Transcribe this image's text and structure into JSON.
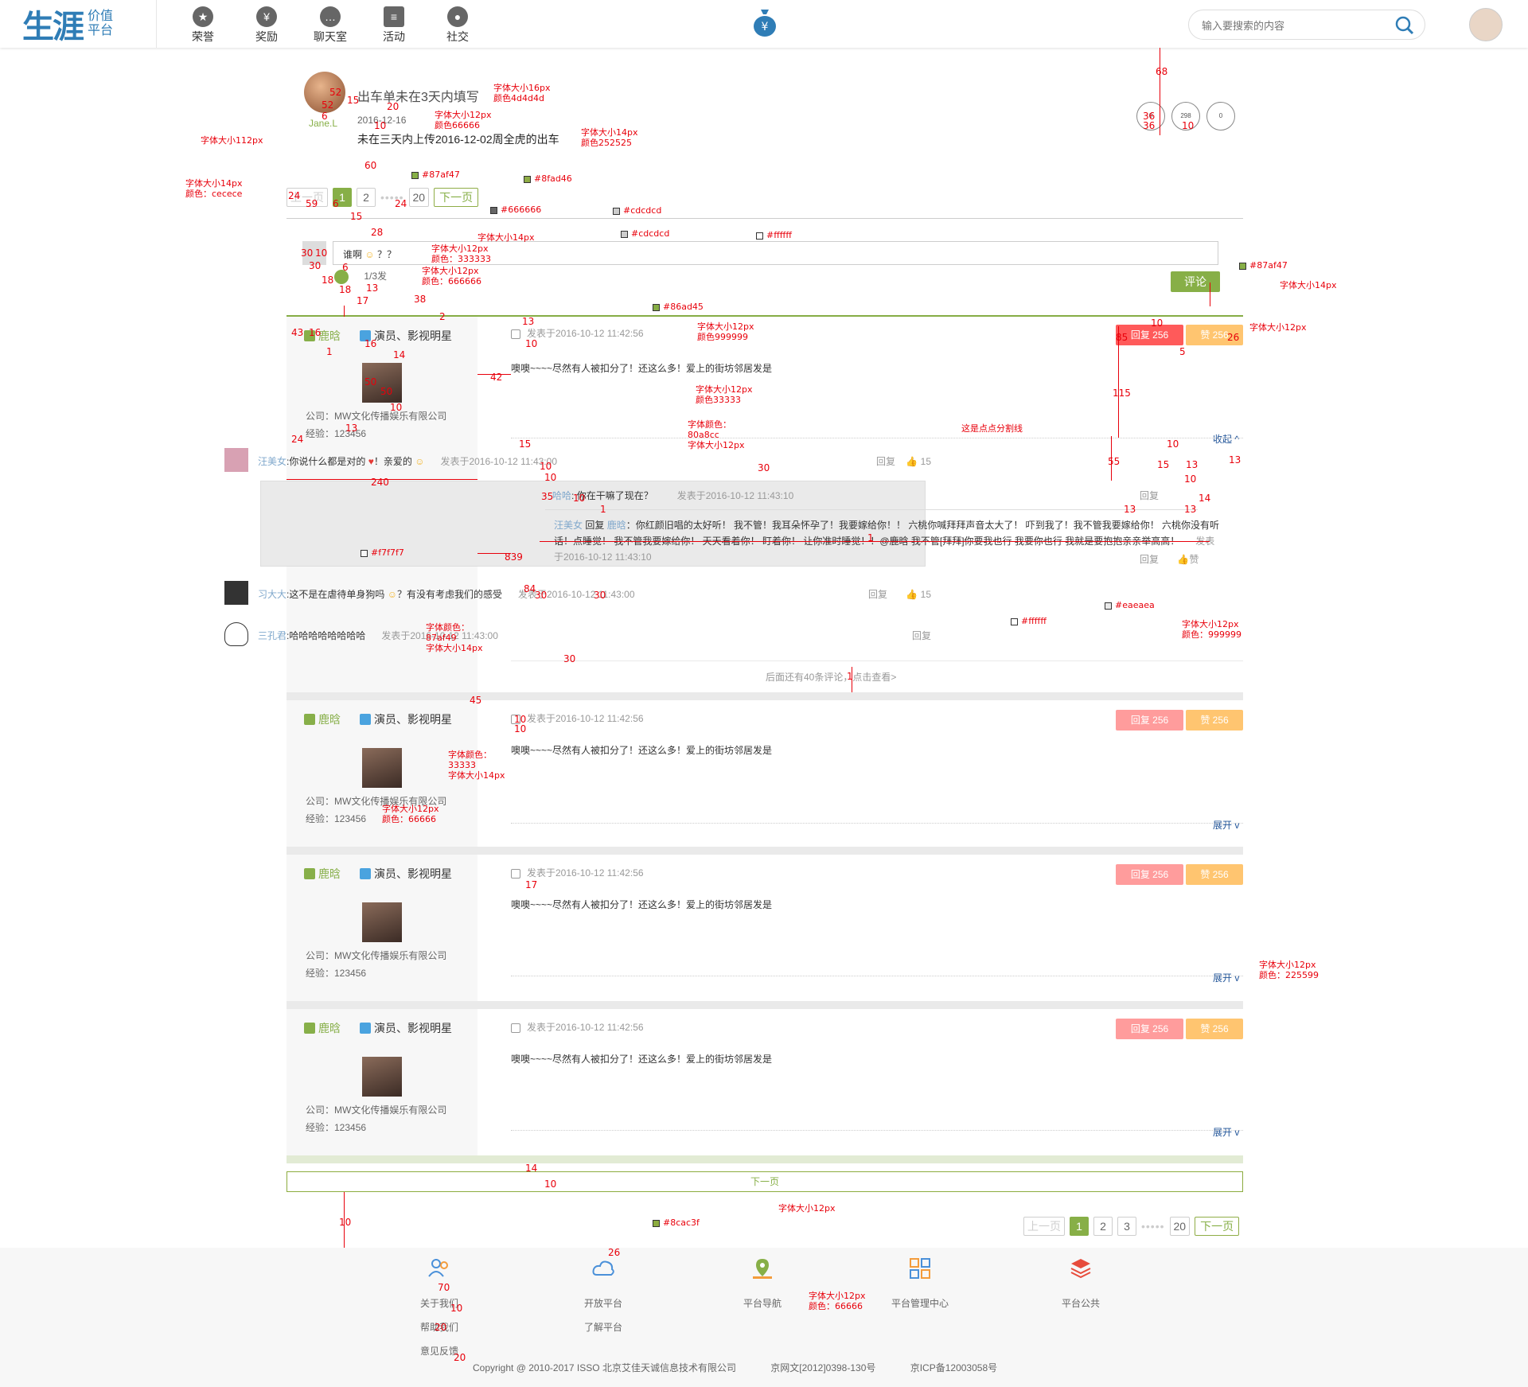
{
  "header": {
    "logo_main": "生涯",
    "logo_sub_1": "价值",
    "logo_sub_2": "平台",
    "nav": [
      {
        "label": "荣誉",
        "icon": "medal-icon"
      },
      {
        "label": "奖励",
        "icon": "money-bag-icon"
      },
      {
        "label": "聊天室",
        "icon": "chat-icon"
      },
      {
        "label": "活动",
        "icon": "calendar-icon"
      },
      {
        "label": "社交",
        "icon": "people-icon"
      }
    ],
    "search_placeholder": "输入要搜索的内容"
  },
  "topic": {
    "user_name": "Jane.L",
    "title": "出车单未在3天内填写",
    "date": "2016-12-16",
    "desc": "未在三天内上传2016-12-02周全虎的出车"
  },
  "badges": [
    "0",
    "298",
    "0"
  ],
  "pager_top": {
    "prev": "上一页",
    "pages": [
      "1",
      "2"
    ],
    "dots": "•••••",
    "last": "20",
    "next": "下一页"
  },
  "comment_input": {
    "text": "谁啊",
    "emoji_label": "？？",
    "count": "1/3发",
    "send": "评论"
  },
  "posts": [
    {
      "name": "鹿晗",
      "role": "演员、影视明星",
      "company": "公司：MW文化传播娱乐有限公司",
      "exp": "经验：123456",
      "time": "发表于2016-10-12 11:42:56",
      "body": "噢噢~~~~尽然有人被扣分了！还这么多！爱上的街坊邻居发是",
      "reply_btn": "回复 256",
      "like_btn": "赞 256",
      "toggle": "收起 ^"
    },
    {
      "name": "鹿晗",
      "role": "演员、影视明星",
      "company": "公司：MW文化传播娱乐有限公司",
      "exp": "经验：123456",
      "time": "发表于2016-10-12 11:42:56",
      "body": "噢噢~~~~尽然有人被扣分了！还这么多！爱上的街坊邻居发是",
      "reply_btn": "回复 256",
      "like_btn": "赞 256",
      "toggle": "展开 v"
    },
    {
      "name": "鹿晗",
      "role": "演员、影视明星",
      "company": "公司：MW文化传播娱乐有限公司",
      "exp": "经验：123456",
      "time": "发表于2016-10-12 11:42:56",
      "body": "噢噢~~~~尽然有人被扣分了！还这么多！爱上的街坊邻居发是",
      "reply_btn": "回复 256",
      "like_btn": "赞 256",
      "toggle": "展开 v"
    },
    {
      "name": "鹿晗",
      "role": "演员、影视明星",
      "company": "公司：MW文化传播娱乐有限公司",
      "exp": "经验：123456",
      "time": "发表于2016-10-12 11:42:56",
      "body": "噢噢~~~~尽然有人被扣分了！还这么多！爱上的街坊邻居发是",
      "reply_btn": "回复 256",
      "like_btn": "赞 256",
      "toggle": "展开 v"
    }
  ],
  "replies": [
    {
      "name": "汪美女",
      "text": ":你说什么都是对的",
      "text2": "！亲爱的",
      "time": "发表于2016-10-12 11:43:00",
      "reply": "回复",
      "likes": "15"
    },
    {
      "name": "哈哈",
      "text": "你在干嘛了现在？",
      "time": "发表于2016-10-12 11:43:10",
      "reply": "回复"
    },
    {
      "name": "汪美女",
      "to": "鹿晗",
      "text": "：你红颜旧唱的太好听！ 我不管！我耳朵怀孕了！我要嫁给你！！ 六桃你喊拜拜声音太大了！ 吓到我了！我不管我要嫁给你！ 六桃你没有听话！点睡觉！ 我不管我要嫁给你！ 天天看着你！ 盯着你！ 让你准时睡觉！！@鹿晗 我不管[拜拜]你要我也行 我要你也行 我就是要抱抱亲亲举高高！",
      "time": "发表于2016-10-12 11:43:10",
      "reply": "回复",
      "like": "赞"
    },
    {
      "name": "习大大",
      "text": ":这不是在虐待单身狗吗",
      "text2": "？有没有考虑我们的感受",
      "time": "发表于2016-10-12 11:43:00",
      "reply": "回复",
      "likes": "15"
    },
    {
      "name": "三孔君",
      "text": ":哈哈哈哈哈哈哈哈",
      "time": "发表于2016-10-12 11:43:00",
      "reply": "回复"
    }
  ],
  "more_text": "后面还有40条评论，点击查看>",
  "bottom_next": "下一页",
  "pager_bottom": {
    "prev": "上一页",
    "pages": [
      "1",
      "2",
      "3"
    ],
    "dots": "•••••",
    "last": "20",
    "next": "下一页"
  },
  "footer": {
    "cols": [
      {
        "icon": "users-icon",
        "items": [
          "关于我们",
          "帮助我们",
          "意见反馈"
        ]
      },
      {
        "icon": "cloud-icon",
        "items": [
          "开放平台",
          "了解平台"
        ]
      },
      {
        "icon": "map-pin-icon",
        "items": [
          "平台导航"
        ]
      },
      {
        "icon": "grid-icon",
        "items": [
          "平台管理中心"
        ]
      },
      {
        "icon": "layers-icon",
        "items": [
          "平台公共"
        ]
      }
    ],
    "copyright": "Copyright @ 2010-2017 ISSO 北京艾佳天诚信息技术有限公司",
    "icp1": "京网文[2012]0398-130号",
    "icp2": "京ICP备12003058号"
  },
  "colors": {
    "green": "#87af47",
    "green_border": "#8fad46",
    "green_line": "#86ad45",
    "next_border": "#8cac3f",
    "line": "#cdcdcd",
    "side_bg": "#f7f7f7",
    "reply_bg": "#eaeaea",
    "reply_btn": "#ff8f8f",
    "like_btn": "#ffc570",
    "link_blue": "#225599"
  },
  "annotations": {
    "a1": "字体大小16px",
    "a1b": "颜色4d4d4d",
    "a2": "字体大小12px",
    "a2b": "颜色66666",
    "a3": "字体大小14px",
    "a3b": "颜色252525",
    "a4": "字体大小112px",
    "a5": "字体大小14px",
    "a5b": "颜色：cecece",
    "c1": "#87af47",
    "c2": "#8fad46",
    "c3": "#666666",
    "c4": "#cdcdcd",
    "c5": "#cdcdcd",
    "c6": "#ffffff",
    "a6": "字体大小14px",
    "a7": "字体大小12px",
    "a7b": "颜色：333333",
    "a8": "字体大小12px",
    "a8b": "颜色：666666",
    "c7": "#87af47",
    "a9": "字体大小14px",
    "c8": "#86ad45",
    "a10": "字体大小12px",
    "a10b": "颜色999999",
    "a11": "字体大小12px",
    "a12": "字体大小12px",
    "a12b": "颜色33333",
    "a13": "字体颜色：",
    "a13b": "80a8cc",
    "a13c": "字体大小12px",
    "a14": "这是点点分割线",
    "c9": "#f7f7f7",
    "c10": "#eaeaea",
    "c11": "#ffffff",
    "a15": "字体大小12px",
    "a15b": "颜色：999999",
    "a16": "字体颜色：",
    "a16b": "87af49",
    "a16c": "字体大小14px",
    "a17": "字体颜色：",
    "a17b": "33333",
    "a17c": "字体大小14px",
    "a18": "字体大小12px",
    "a18b": "颜色：66666",
    "a19": "字体大小12px",
    "a19b": "颜色：225599",
    "a20": "字体大小12px",
    "c12": "#8cac3f",
    "a21": "字体大小12px",
    "a21b": "颜色：66666",
    "m": [
      "68",
      "36",
      "36",
      "10",
      "52",
      "15",
      "52",
      "20",
      "10",
      "6",
      "60",
      "24",
      "59",
      "6",
      "15",
      "24",
      "28",
      "30",
      "10",
      "30",
      "6",
      "18",
      "18",
      "13",
      "17",
      "38",
      "2",
      "13",
      "10",
      "43",
      "16",
      "1",
      "16",
      "14",
      "50",
      "50",
      "10",
      "13",
      "42",
      "10",
      "85",
      "26",
      "5",
      "115",
      "24",
      "240",
      "15",
      "10",
      "10",
      "35",
      "10",
      "1",
      "30",
      "13",
      "55",
      "10",
      "13",
      "15",
      "10",
      "14",
      "13",
      "13",
      "1",
      "839",
      "84",
      "30",
      "30",
      "30",
      "1",
      "45",
      "10",
      "10",
      "17",
      "14",
      "10",
      "10",
      "26",
      "70",
      "10",
      "20",
      "20",
      "20",
      "15"
    ]
  }
}
